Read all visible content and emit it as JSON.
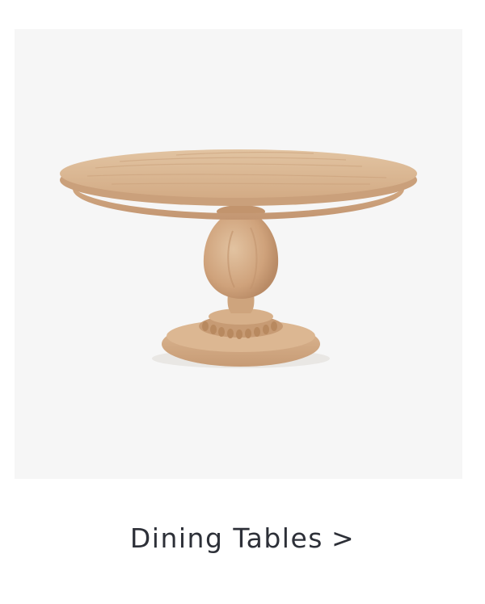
{
  "category_card": {
    "label": "Dining Tables",
    "arrow": ">",
    "image_subject": "round-pedestal-dining-table",
    "colors": {
      "background": "#f6f6f6",
      "text": "#2d3038",
      "wood": "#d9b48f"
    }
  }
}
